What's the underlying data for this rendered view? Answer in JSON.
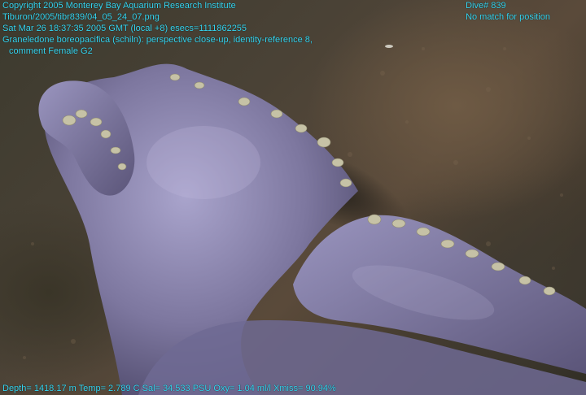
{
  "overlay": {
    "top_left": [
      "Copyright 2005 Monterey Bay Aquarium Research Institute",
      "Tiburon/2005/tibr839/04_05_24_07.png",
      "Sat Mar 26 18:37:35 2005 GMT (local +8)  esecs=1111862255",
      "Graneledone boreopacifica (schiln): perspective close-up, identity-reference 8,",
      "comment Female G2"
    ],
    "top_right": [
      "Dive# 839",
      "No match for position"
    ],
    "bottom": "Depth= 1418.17 m  Temp= 2.789 C  Sal= 34.533 PSU  Oxy= 1.04 ml/l  Xmiss= 90.94%"
  },
  "colors": {
    "overlay_text": "#38d7f2",
    "octopus": "#8a84b0",
    "sediment": "#5a4a3a"
  }
}
